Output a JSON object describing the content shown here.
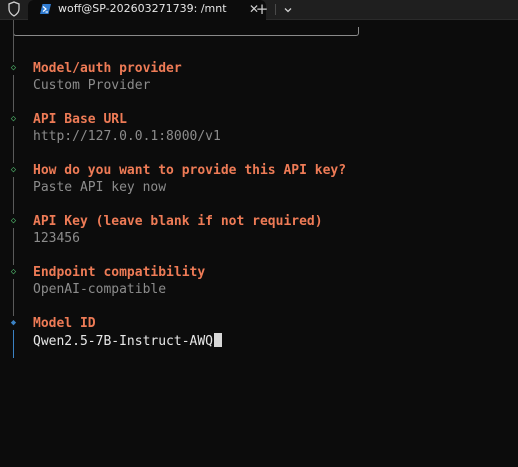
{
  "window": {
    "tab_title": "woff@SP-202603271739: /mnt",
    "tab_close": "✕",
    "new_tab": "+",
    "shield_icon": "shield-icon",
    "shell_icon": "powershell-icon",
    "dropdown_icon": "chevron-down-icon"
  },
  "colors": {
    "label": "#ee7b56",
    "value": "#8c8c8c",
    "done_marker": "#4fb36a",
    "active_marker": "#3b82c4"
  },
  "steps": [
    {
      "label": "Model/auth provider",
      "value": "Custom Provider",
      "status": "done"
    },
    {
      "label": "API Base URL",
      "value": "http://127.0.0.1:8000/v1",
      "status": "done"
    },
    {
      "label": "How do you want to provide this API key?",
      "value": "Paste API key now",
      "status": "done"
    },
    {
      "label": "API Key (leave blank if not required)",
      "value": "123456",
      "status": "done"
    },
    {
      "label": "Endpoint compatibility",
      "value": "OpenAI-compatible",
      "status": "done"
    },
    {
      "label": "Model ID",
      "value": "Qwen2.5-7B-Instruct-AWQ",
      "status": "active"
    }
  ],
  "markers": {
    "done": "◇",
    "active": "◆"
  }
}
